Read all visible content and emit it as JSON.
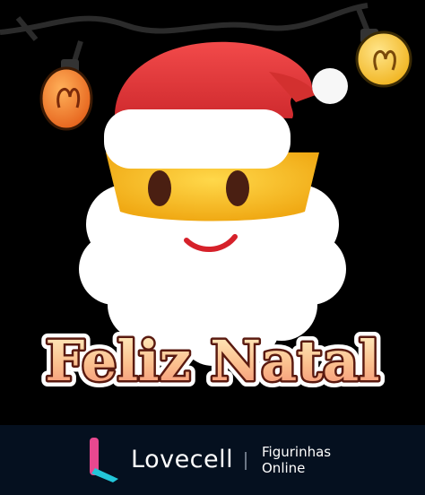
{
  "sticker": {
    "greeting": "Feliz Natal",
    "icons": [
      "string-lights-icon",
      "santa-hat-icon",
      "smiley-face-icon",
      "beard-icon"
    ],
    "colors": {
      "hat_red": "#e8373b",
      "hat_white": "#ffffff",
      "face_yellow": "#f6c21c",
      "bulb_orange": "#f07a26",
      "bulb_yellow": "#f9c52f",
      "text_top": "#fff3c4",
      "text_bottom": "#f48f74",
      "text_outline": "#5a1a10"
    }
  },
  "footer": {
    "brand": "Lovecell",
    "tagline_line1": "Figurinhas",
    "tagline_line2": "Online",
    "colors": {
      "background": "#05101f",
      "logo_pink": "#e8488f",
      "logo_cyan": "#23c6d9"
    }
  }
}
